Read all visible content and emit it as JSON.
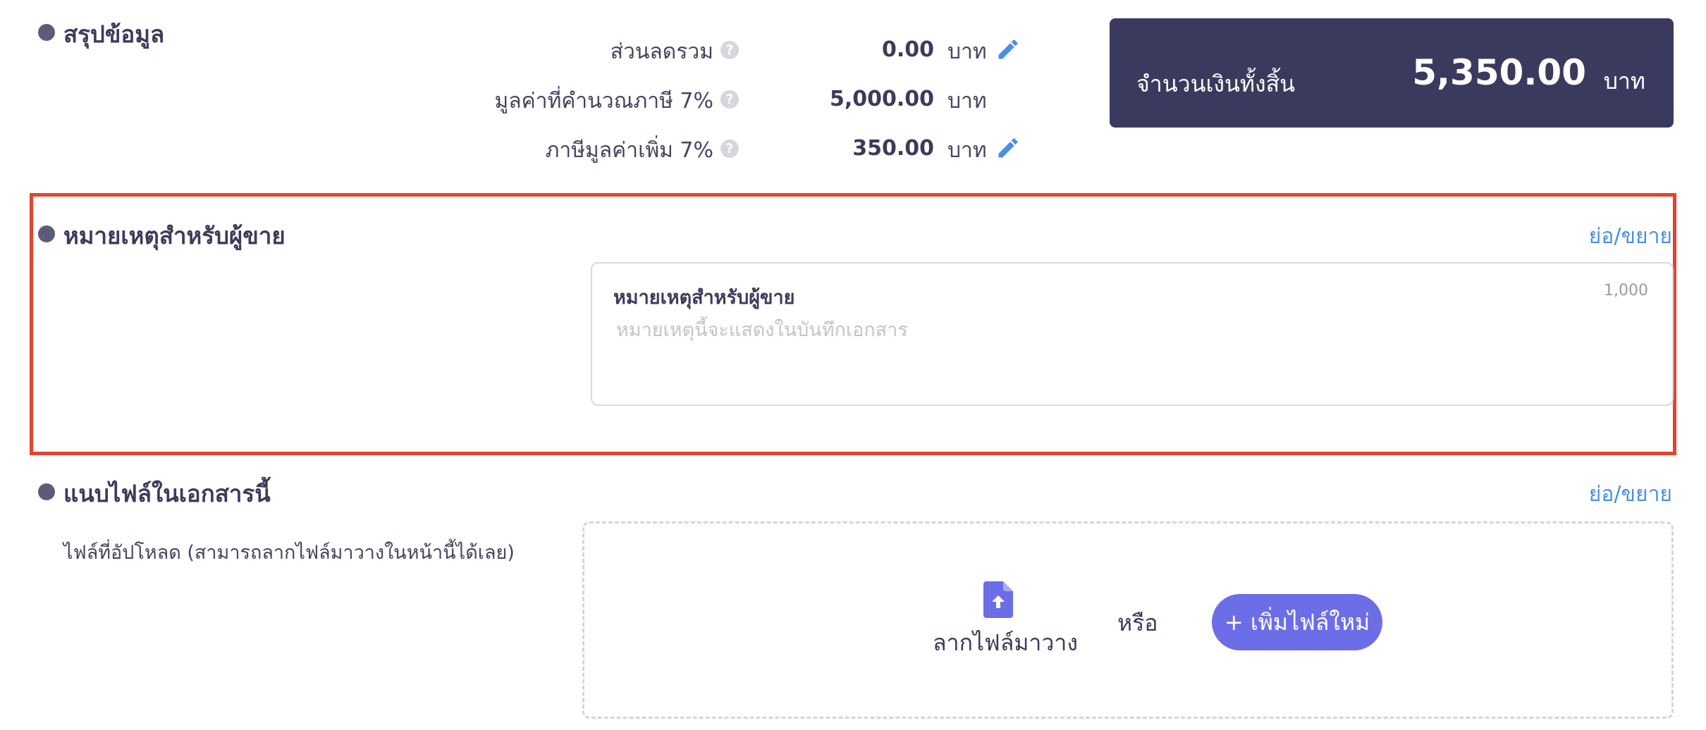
{
  "summary": {
    "title": "สรุปข้อมูล",
    "rows": [
      {
        "label": "ส่วนลดรวม",
        "value": "0.00",
        "unit": "บาท",
        "editable": true
      },
      {
        "label": "มูลค่าที่คำนวณภาษี 7%",
        "value": "5,000.00",
        "unit": "บาท",
        "editable": false
      },
      {
        "label": "ภาษีมูลค่าเพิ่ม 7%",
        "value": "350.00",
        "unit": "บาท",
        "editable": true
      }
    ],
    "help_glyph": "?",
    "total": {
      "label": "จำนวนเงินทั้งสิ้น",
      "value": "5,350.00",
      "unit": "บาท"
    }
  },
  "seller_note": {
    "title": "หมายเหตุสำหรับผู้ขาย",
    "toggle": "ย่อ/ขยาย",
    "field_label": "หมายเหตุสำหรับผู้ขาย",
    "char_limit": "1,000",
    "placeholder": "หมายเหตุนี้จะแสดงในบันทึกเอกสาร"
  },
  "attachments": {
    "title": "แนบไฟล์ในเอกสารนี้",
    "toggle": "ย่อ/ขยาย",
    "hint": "ไฟล์ที่อัปโหลด (สามารถลากไฟล์มาวางในหน้านี้ได้เลย)",
    "drag_label": "ลากไฟล์มาวาง",
    "or_label": "หรือ",
    "add_button": "+ เพิ่มไฟล์ใหม่"
  },
  "colors": {
    "accent": "#6c6ee8",
    "link": "#4a8fe7",
    "highlight": "#e5432f",
    "total_bg": "#3b3a5e"
  },
  "icons": {
    "edit": "pencil-icon",
    "help": "question-circle-icon",
    "upload": "file-upload-icon",
    "bullet": "bullet-dot"
  }
}
